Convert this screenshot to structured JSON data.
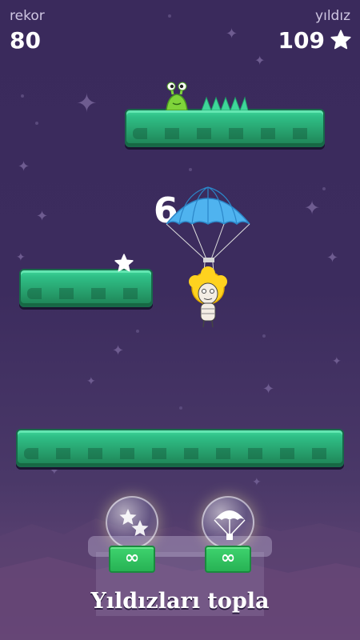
{
  "hud": {
    "record_label": "rekor",
    "record_value": "80",
    "stars_label": "yıldız",
    "stars_value": "109"
  },
  "game": {
    "current_score": "6",
    "character": "parachuting-curly-haired-hero",
    "enemy": "green-slug-monster"
  },
  "powerups": [
    {
      "name": "star-bubble",
      "count": "∞"
    },
    {
      "name": "parachute-bubble",
      "count": "∞"
    }
  ],
  "caption": "Yıldızları topla",
  "colors": {
    "background": "#3c2c5e",
    "platform": "#2fbf86",
    "button": "#27b254",
    "parachute": "#4fb3ef"
  }
}
